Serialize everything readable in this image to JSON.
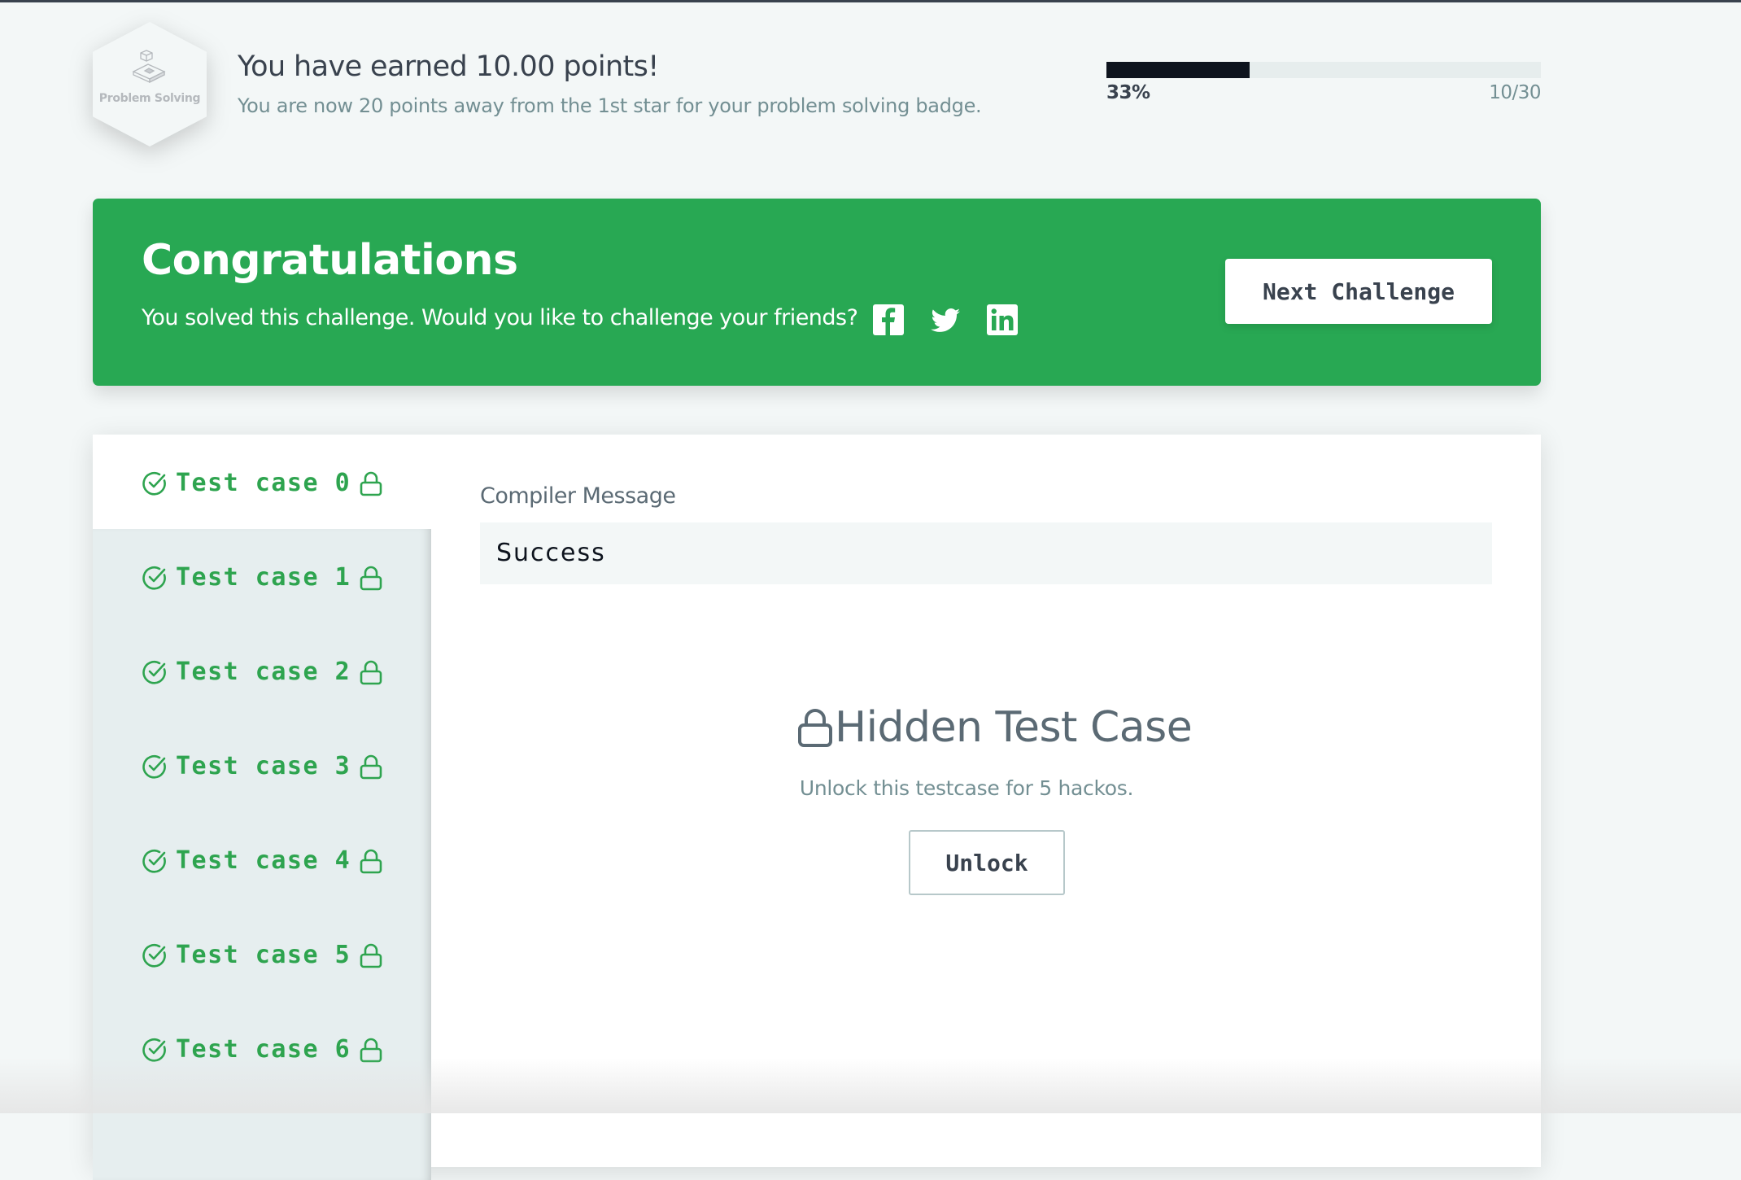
{
  "header": {
    "badge_label": "Problem Solving",
    "earned_title": "You have earned 10.00 points!",
    "earned_subtitle": "You are now 20 points away from the 1st star for your problem solving badge.",
    "progress": {
      "percent_label": "33%",
      "fraction": 0.33,
      "count_label": "10/30"
    }
  },
  "banner": {
    "title": "Congratulations",
    "subtitle": "You solved this challenge. Would you like to challenge your friends?",
    "social": [
      "facebook-icon",
      "twitter-icon",
      "linkedin-icon"
    ],
    "next_button": "Next Challenge",
    "color": "#28a853"
  },
  "testcases": {
    "active_index": 0,
    "items": [
      {
        "label": "Test case 0",
        "status": "passed",
        "locked": true
      },
      {
        "label": "Test case 1",
        "status": "passed",
        "locked": true
      },
      {
        "label": "Test case 2",
        "status": "passed",
        "locked": true
      },
      {
        "label": "Test case 3",
        "status": "passed",
        "locked": true
      },
      {
        "label": "Test case 4",
        "status": "passed",
        "locked": true
      },
      {
        "label": "Test case 5",
        "status": "passed",
        "locked": true
      },
      {
        "label": "Test case 6",
        "status": "passed",
        "locked": true
      }
    ],
    "pass_color": "#2ea44f"
  },
  "result": {
    "compiler_label": "Compiler Message",
    "compiler_value": "Success",
    "hidden_title": "Hidden Test Case",
    "hidden_subtitle": "Unlock this testcase for 5 hackos.",
    "unlock_button": "Unlock"
  }
}
